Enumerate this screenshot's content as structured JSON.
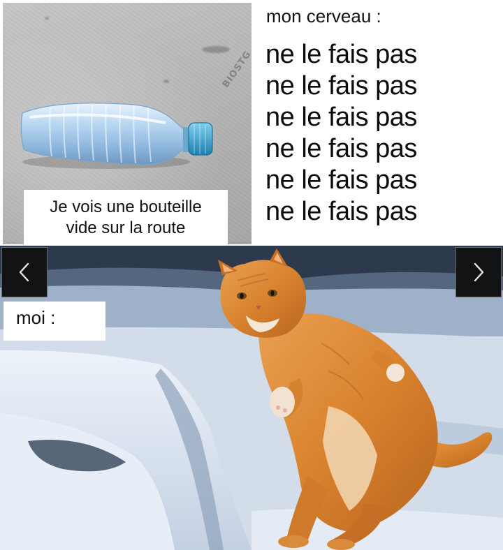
{
  "meme": {
    "top_left": {
      "caption_line1": "Je vois une bouteille",
      "caption_line2": "vide sur la route",
      "watermark": "BIOSTG"
    },
    "top_right": {
      "title": "mon cerveau :",
      "lines": [
        "ne le fais pas",
        "ne le fais pas",
        "ne le fais pas",
        "ne le fais pas",
        "ne le fais pas",
        "ne le fais pas"
      ]
    },
    "bottom": {
      "label": "moi :"
    }
  },
  "viewer": {
    "prev_icon": "chevron-left-icon",
    "next_icon": "chevron-right-icon"
  },
  "colors": {
    "nav_bg": "#111315",
    "cat_orange": "#d9832f",
    "bottle_blue": "#9fc6ea"
  }
}
